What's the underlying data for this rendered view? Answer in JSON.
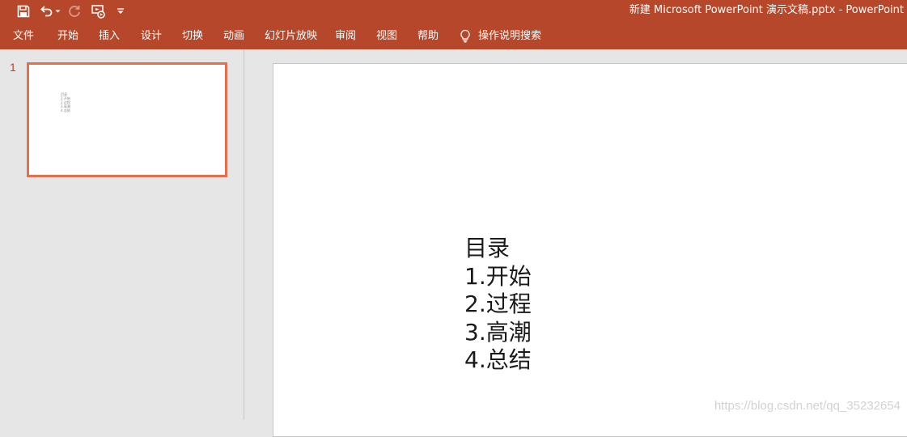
{
  "window": {
    "title": "新建 Microsoft PowerPoint 演示文稿.pptx  -  PowerPoint"
  },
  "quick_access": [
    {
      "name": "save-icon"
    },
    {
      "name": "undo-icon"
    },
    {
      "name": "redo-icon"
    },
    {
      "name": "start-slideshow-icon"
    },
    {
      "name": "customize-toolbar-icon"
    }
  ],
  "ribbon": {
    "tabs": [
      "文件",
      "开始",
      "插入",
      "设计",
      "切换",
      "动画",
      "幻灯片放映",
      "审阅",
      "视图",
      "帮助"
    ],
    "tell_me": "操作说明搜索"
  },
  "thumbnails": {
    "number": "1",
    "lines": [
      "目录",
      "1.开始",
      "2.过程",
      "3.高潮",
      "4.总结"
    ]
  },
  "slide": {
    "lines": [
      "目录",
      "1.开始",
      "2.过程",
      "3.高潮",
      "4.总结"
    ]
  },
  "watermark": "https://blog.csdn.net/qq_35232654",
  "colors": {
    "accent": "#b7472a",
    "thumbnail_selection": "#e5704d"
  }
}
